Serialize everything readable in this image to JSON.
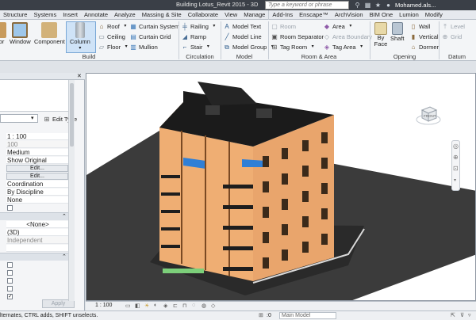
{
  "window": {
    "title": "Building Lotus_Revit 2015 - 3D Vie...",
    "search_placeholder": "Type a keyword or phrase",
    "user": "Mohamed.als..."
  },
  "ribbon_tabs": [
    "Structure",
    "Systems",
    "Insert",
    "Annotate",
    "Analyze",
    "Massing & Site",
    "Collaborate",
    "View",
    "Manage",
    "Add-Ins",
    "Enscape™",
    "ArchVision",
    "BIM One",
    "Lumion",
    "Modify"
  ],
  "build": {
    "label": "Build",
    "door": "or",
    "window": "Window",
    "component": "Component",
    "column": "Column",
    "roof": "Roof",
    "ceiling": "Ceiling",
    "floor": "Floor",
    "curtain_system": "Curtain System",
    "curtain_grid": "Curtain Grid",
    "mullion": "Mullion"
  },
  "circulation": {
    "label": "Circulation",
    "railing": "Railing",
    "ramp": "Ramp",
    "stair": "Stair"
  },
  "model": {
    "label": "Model",
    "text": "Model Text",
    "line": "Model Line",
    "group": "Model Group"
  },
  "room_area": {
    "label": "Room & Area",
    "room": "Room",
    "room_separator": "Room Separator",
    "tag_room": "Tag Room",
    "area": "Area",
    "area_boundary": "Area Boundary",
    "tag_area": "Tag Area"
  },
  "opening": {
    "label": "Opening",
    "by_face": "By Face",
    "shaft": "Shaft",
    "wall": "Wall",
    "vertical": "Vertical",
    "dormer": "Dormer"
  },
  "datum": {
    "label": "Datum",
    "level": "Level",
    "grid": "Grid"
  },
  "properties": {
    "edit_type": "Edit Type",
    "scale": "1 : 100",
    "scale_value": "100",
    "detail": "Medium",
    "parts": "Show Original",
    "edit1": "Edit...",
    "edit2": "Edit...",
    "discipline": "Coordination",
    "color_scheme": "By Discipline",
    "none": "None",
    "section_none": "<None>",
    "view_name": "(3D)",
    "dependency": "Independent",
    "apply": "Apply"
  },
  "viewbar": {
    "scale": "1 : 100"
  },
  "status": {
    "hint": "lternates, CTRL adds, SHIFT unselects.",
    "model": "Main Model",
    "zero": ":0"
  },
  "viewcube": {
    "face": "FRONT"
  },
  "colors": {
    "facade": "#e9a56c",
    "roof": "#1c1c1c",
    "ground": "#3c3c3c",
    "glass": "#2f7fd6",
    "accent": "#cfe3f7"
  }
}
